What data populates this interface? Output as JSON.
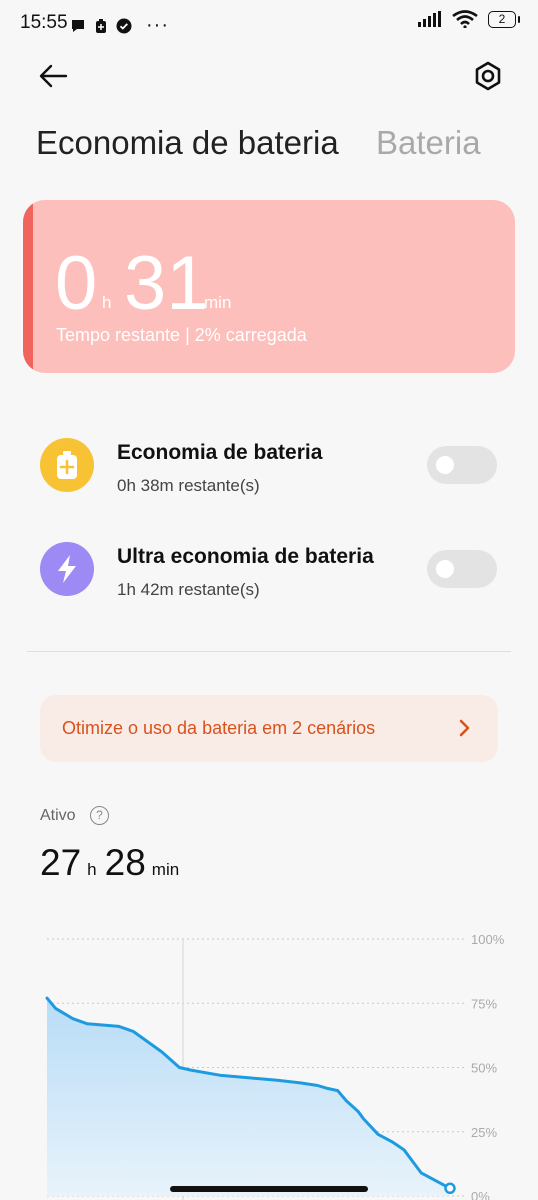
{
  "status_bar": {
    "time": "15:55",
    "dots": "···",
    "battery_level": "2"
  },
  "header": {
    "tab_active": "Economia de bateria",
    "tab_inactive": "Bateria",
    "back_icon": "arrow-left-icon",
    "settings_icon": "gear-icon"
  },
  "summary": {
    "hours": "0",
    "hours_unit": "h",
    "minutes": "31",
    "minutes_unit": "min",
    "subtitle": "Tempo restante | 2% carregada",
    "accent_color": "#f0645d",
    "card_color": "#fdbfbb"
  },
  "modes": [
    {
      "title": "Economia de bateria",
      "subtitle": "0h 38m restante(s)",
      "enabled": false,
      "icon": "battery-plus-icon",
      "icon_color": "#f8c235"
    },
    {
      "title": "Ultra economia de bateria",
      "subtitle": "1h 42m restante(s)",
      "enabled": false,
      "icon": "lightning-icon",
      "icon_color": "#9d8af5"
    }
  ],
  "banner": {
    "text": "Otimize o uso da bateria em 2 cenários",
    "color": "#d9521c"
  },
  "usage": {
    "label": "Ativo",
    "hours": "27",
    "hours_unit": "h",
    "minutes": "28",
    "minutes_unit": "min"
  },
  "chart_data": {
    "type": "area",
    "y_ticks": [
      "100%",
      "75%",
      "50%",
      "25%",
      "0%"
    ],
    "ylim": [
      0,
      100
    ],
    "line_color": "#1e9be0",
    "x": [
      0,
      3,
      9,
      14,
      25,
      30,
      40,
      46,
      50,
      60,
      70,
      80,
      88,
      94,
      97,
      101,
      104,
      108,
      110,
      115,
      120,
      124,
      130,
      140
    ],
    "values": [
      77,
      73,
      69,
      67,
      66,
      64,
      56,
      50,
      49,
      47,
      46,
      45,
      44,
      43,
      42,
      41,
      37,
      33,
      30,
      24,
      21,
      18,
      9,
      3
    ]
  }
}
